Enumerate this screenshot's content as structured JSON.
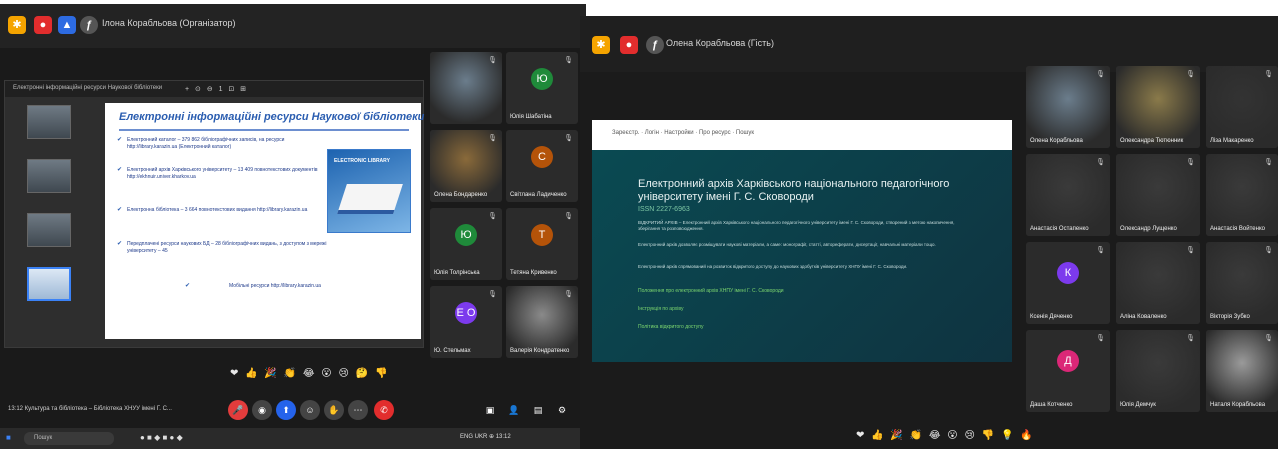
{
  "left": {
    "title": "Ілона Корабльова (Організатор)",
    "share_toolbar": "Електронні інформаційні ресурси Наукової бібліотеки",
    "share_tools": "+ ⊙ ⊖ 1 ⊡ ⊞",
    "slide": {
      "title": "Електронні інформаційні ресурси Наукової бібліотеки",
      "bullets": [
        "Електронний каталог – 379 862 бібліографічних записів, на ресурси http://library.karazin.ua (Електронний каталог)",
        "Електронний архів Харківського університету – 13 409 повнотекстових документів http://ekhnuir.univer.kharkov.ua",
        "Електронна бібліотека – 3 664 повнотекстових видання http://library.karazin.ua",
        "Передплачені ресурси наукових БД – 28 бібліографічних видань, з доступом з мережі університету – 45",
        "Мобільні ресурси http://library.karazin.ua"
      ],
      "image_label": "ELECTRONIC LIBRARY"
    },
    "tiles": [
      {
        "name": "",
        "avatar": "",
        "color": "#6b7d8c"
      },
      {
        "name": "Юлія Шабатіна",
        "avatar": "Ю",
        "color": "#1f8a3a"
      },
      {
        "name": "Олена Бондаренко",
        "avatar": "",
        "color": "#8a6a3a"
      },
      {
        "name": "Світлана Ладиченко",
        "avatar": "С",
        "color": "#b45309"
      },
      {
        "name": "Юлія Толрінська",
        "avatar": "Ю",
        "color": "#1f8a3a"
      },
      {
        "name": "Тетяна Кривенко",
        "avatar": "Т",
        "color": "#b45309"
      },
      {
        "name": "Ю. Стельмах",
        "avatar": "Е О",
        "color": "#7c3aed"
      },
      {
        "name": "Валерія Кондратенко",
        "avatar": "",
        "color": "#8a8a8a"
      }
    ],
    "reactions": "❤ 👍 🎉 👏 😂 😮 😢 🤔 👎",
    "control_title": "13:12  Культура та бібліотека – Бібліотека ХНУУ імені Г. С...",
    "taskbar_search": "Пошук",
    "taskbar_tray": "ENG UKR  ⊕ 13:12"
  },
  "right": {
    "title": "Олена Корабльова (Гість)",
    "web": {
      "nav": "Зареєстр. · Логін · Настройки · Про ресурс · Пошук",
      "heading": "Електронний архів Харківського національного педагогічного університету імені Г. С. Сковороди",
      "issn": "ISSN 2227-6963",
      "paragraphs": [
        "ВІДКРИТИЙ АРХІВ – Електронний архів Харківського національного педагогічного університету імені Г. С. Сковороди, створений з метою накопичення, зберігання та розповсюдження.",
        "Електронний архів дозволяє розміщувати наукові матеріали, а саме: монографії, статті, автореферати, дисертації, навчальні матеріали тощо.",
        "Електронний архів спрямований на розвиток відкритого доступу до наукових здобутків університету ХНПУ імені Г. С. Сковороди."
      ],
      "links": [
        "Положення про електронний архів ХНПУ імені Г. С. Сковороди",
        "Інструкція по архіву",
        "Політика відкритого доступу"
      ]
    },
    "tiles": [
      {
        "name": "Олена Корабльова",
        "avatar": "",
        "color": "#6b7d8c"
      },
      {
        "name": "Олександра Тютюнник",
        "avatar": "",
        "color": "#8a7a4a"
      },
      {
        "name": "Ліза Макаренко",
        "avatar": "",
        "color": "#333333"
      },
      {
        "name": "Анастасія Остапенко",
        "avatar": "",
        "color": "#3a3a3a"
      },
      {
        "name": "Олександр Лущенко",
        "avatar": "",
        "color": "#3a3a3a"
      },
      {
        "name": "Анастасія Войтенко",
        "avatar": "",
        "color": "#3a3a3a"
      },
      {
        "name": "Ксенія Дяченко",
        "avatar": "К",
        "color": "#7c3aed"
      },
      {
        "name": "Аліна Коваленко",
        "avatar": "",
        "color": "#3a3a3a"
      },
      {
        "name": "Вікторія Зубко",
        "avatar": "",
        "color": "#3a3a3a"
      },
      {
        "name": "Даша Котченко",
        "avatar": "Д",
        "color": "#db2777"
      },
      {
        "name": "Юлія Демчук",
        "avatar": "",
        "color": "#3a3a3a"
      },
      {
        "name": "Наталя Корабльова",
        "avatar": "",
        "color": "#9a9a9a"
      }
    ],
    "reactions": "❤ 👍 🎉 👏 😂 😮 😢 👎 💡 🔥"
  }
}
